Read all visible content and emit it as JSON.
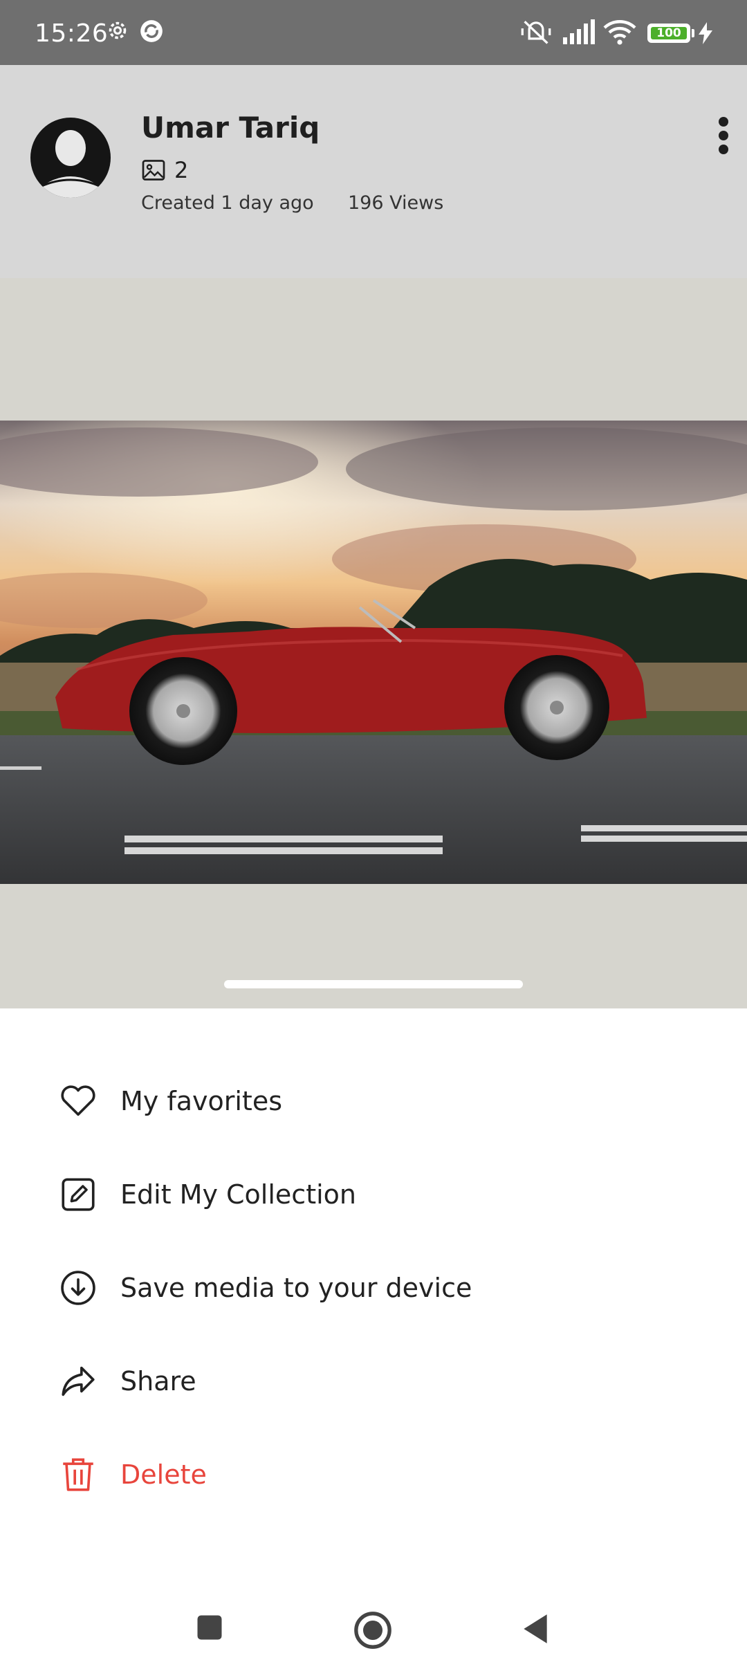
{
  "status_bar": {
    "time": "15:26",
    "battery": "100",
    "icons": [
      "settings-icon",
      "sync-icon",
      "vibrate-off-icon",
      "signal-icon",
      "wifi-icon",
      "battery-icon",
      "charging-icon"
    ]
  },
  "profile": {
    "name": "Umar Tariq",
    "media_count": "2",
    "created": "Created 1 day ago",
    "views": "196 Views"
  },
  "menu": {
    "items": [
      {
        "label": "My favorites",
        "icon": "heart-icon"
      },
      {
        "label": "Edit My Collection",
        "icon": "edit-icon"
      },
      {
        "label": "Save media to your device",
        "icon": "download-icon"
      },
      {
        "label": "Share",
        "icon": "share-icon"
      },
      {
        "label": "Delete",
        "icon": "trash-icon"
      }
    ]
  },
  "colors": {
    "danger": "#e8453c",
    "scrim_header": "#d7d7d7",
    "scrim_media": "#d6d5ce",
    "status_bar": "#6f6f6f"
  }
}
